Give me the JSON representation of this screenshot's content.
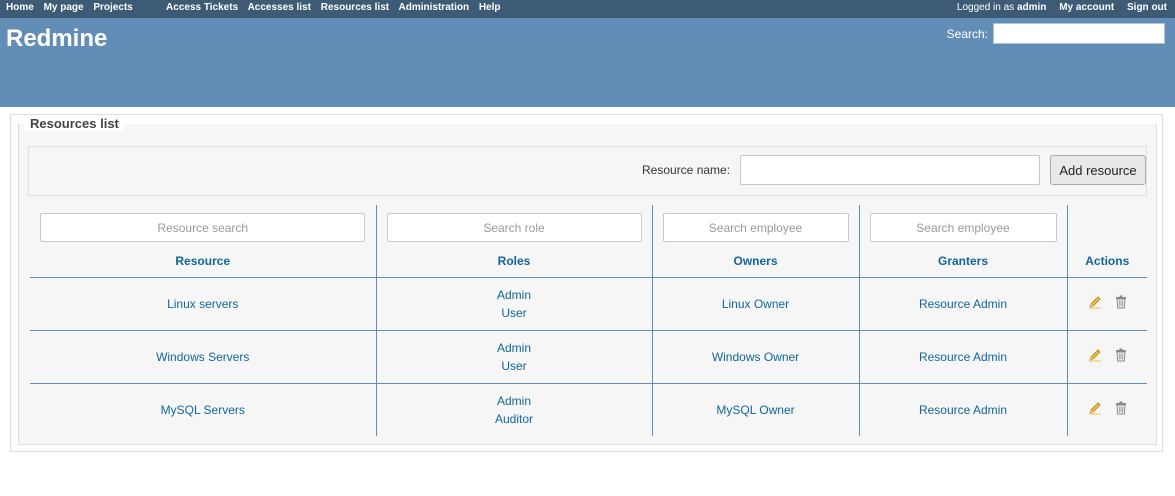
{
  "top_menu": {
    "left": [
      "Home",
      "My page",
      "Projects"
    ],
    "center": [
      "Access Tickets",
      "Accesses list",
      "Resources list",
      "Administration",
      "Help"
    ],
    "logged_in_prefix": "Logged in as",
    "user": "admin",
    "my_account": "My account",
    "sign_out": "Sign out"
  },
  "header": {
    "title": "Redmine",
    "search_label": "Search:"
  },
  "panel": {
    "legend": "Resources list",
    "resource_name_label": "Resource name:",
    "add_button": "Add resource"
  },
  "table": {
    "filters": [
      "Resource search",
      "Search role",
      "Search employee",
      "Search employee"
    ],
    "headers": [
      "Resource",
      "Roles",
      "Owners",
      "Granters",
      "Actions"
    ],
    "rows": [
      {
        "resource": "Linux servers",
        "roles": [
          "Admin",
          "User"
        ],
        "owner": "Linux Owner",
        "granter": "Resource Admin"
      },
      {
        "resource": "Windows Servers",
        "roles": [
          "Admin",
          "User"
        ],
        "owner": "Windows Owner",
        "granter": "Resource Admin"
      },
      {
        "resource": "MySQL Servers",
        "roles": [
          "Admin",
          "Auditor"
        ],
        "owner": "MySQL Owner",
        "granter": "Resource Admin"
      }
    ],
    "action_icons": [
      "pencil-icon",
      "trash-icon"
    ]
  },
  "colors": {
    "top_menu_bg": "#3e5b76",
    "header_bg": "#628db6",
    "link": "#116699",
    "divider": "#628db6"
  }
}
